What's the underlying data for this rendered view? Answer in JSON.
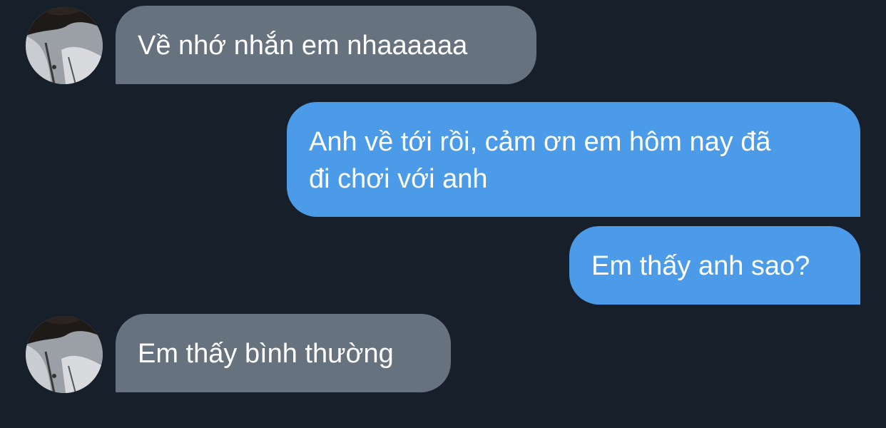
{
  "conversation": {
    "messages": [
      {
        "direction": "received",
        "text": "Về nhớ nhắn em nhaaaaaa"
      },
      {
        "direction": "sent",
        "line1": "Anh về tới rồi, cảm ơn em hôm nay đã",
        "line2": "đi chơi với anh"
      },
      {
        "direction": "sent",
        "text": "Em thấy anh sao?"
      },
      {
        "direction": "received",
        "text": "Em thấy bình thường"
      }
    ],
    "avatar_icon": "contact-avatar-photo"
  },
  "colors": {
    "background": "#171f2a",
    "received_bubble": "#67727f",
    "sent_bubble": "#4c9be8",
    "text": "#ffffff"
  }
}
